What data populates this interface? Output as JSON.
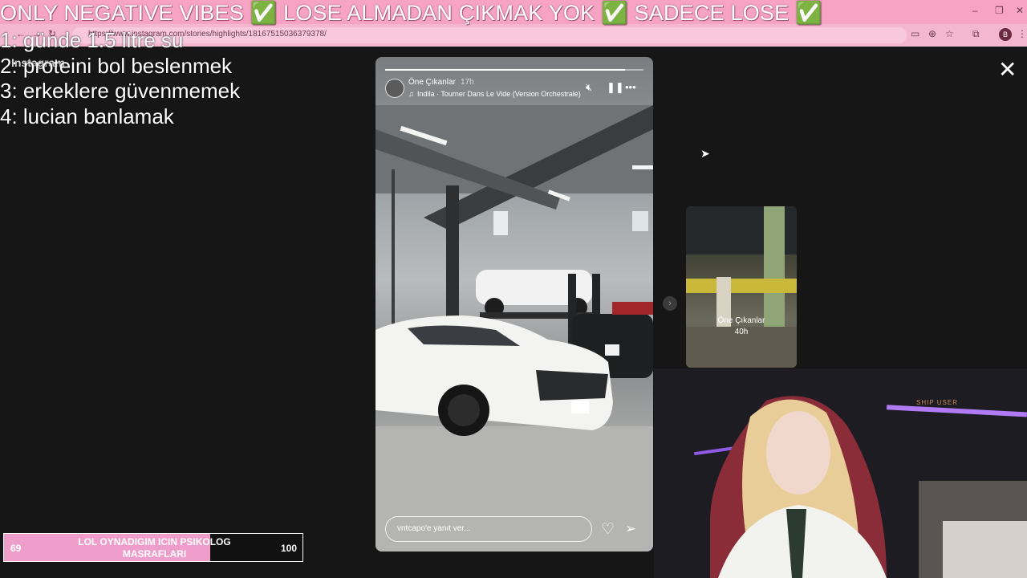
{
  "browser": {
    "url": "https://www.instagram.com/stories/highlights/18167515036379378/",
    "profile_initial": "B",
    "window_controls": [
      "–",
      "❐",
      "✕"
    ]
  },
  "overlay": {
    "ticker": "ONLY NEGATIVE VIBES ✅ LOSE ALMADAN ÇIKMAK YOK ✅ SADECE LOSE ✅",
    "todo": [
      "1: günde 1.5 litre su",
      "2: proteini bol beslenmek",
      "3: erkeklere güvenmemek",
      "4: lucian banlamak"
    ],
    "brand_text": "Instagram"
  },
  "story": {
    "username": "Öne Çıkanlar",
    "time": "17h",
    "song": "Indila · Tourner Dans Le Vide (Version Orchestrale)",
    "reply_placeholder": "vntcapo'e yanıt ver...",
    "progress_fraction": 0.93,
    "icons": {
      "music": "music-note-icon",
      "mute": "mute-icon",
      "pause": "pause-icon",
      "more": "more-icon",
      "like": "heart-icon",
      "share": "send-icon"
    }
  },
  "next_story": {
    "label": "Öne Çıkanlar",
    "time": "40h"
  },
  "webcam": {
    "neon_text": "SHIP USER"
  },
  "goal": {
    "title": "LOL OYNADIGIM ICIN PSIKOLOG MASRAFLARI",
    "current": "69",
    "target": "100",
    "progress_fraction": 0.69,
    "fill_color": "#ef9ecb"
  }
}
